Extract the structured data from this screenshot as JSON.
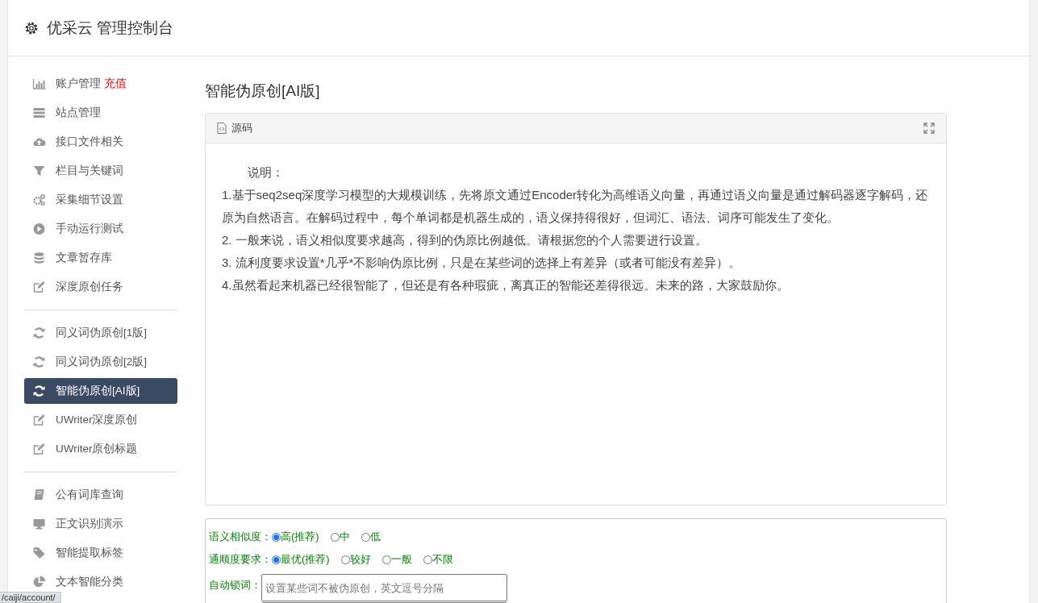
{
  "header": {
    "title": "优采云 管理控制台"
  },
  "sidebar": {
    "groups": [
      [
        {
          "kind": "chart",
          "label": "账户管理",
          "badge": "充值",
          "selected": false
        },
        {
          "kind": "server",
          "label": "站点管理",
          "selected": false
        },
        {
          "kind": "cloud",
          "label": "接口文件相关",
          "selected": false
        },
        {
          "kind": "filter",
          "label": "栏目与关键词",
          "selected": false
        },
        {
          "kind": "gears",
          "label": "采集细节设置",
          "selected": false
        },
        {
          "kind": "play",
          "label": "手动运行测试",
          "selected": false
        },
        {
          "kind": "database",
          "label": "文章暂存库",
          "selected": false
        },
        {
          "kind": "edit",
          "label": "深度原创任务",
          "selected": false
        }
      ],
      [
        {
          "kind": "refresh",
          "label": "同义词伪原创[1版]",
          "selected": false
        },
        {
          "kind": "refresh",
          "label": "同义词伪原创[2版]",
          "selected": false
        },
        {
          "kind": "refresh",
          "label": "智能伪原创[AI版]",
          "selected": true
        },
        {
          "kind": "edit",
          "label": "UWriter深度原创",
          "selected": false
        },
        {
          "kind": "edit",
          "label": "UWriter原创标题",
          "selected": false
        }
      ],
      [
        {
          "kind": "book",
          "label": "公有词库查询",
          "selected": false
        },
        {
          "kind": "monitor",
          "label": "正文识别演示",
          "selected": false
        },
        {
          "kind": "tag",
          "label": "智能提取标签",
          "selected": false
        },
        {
          "kind": "pie",
          "label": "文本智能分类",
          "selected": false
        }
      ]
    ]
  },
  "page_title": "智能伪原创[AI版]",
  "source_panel": {
    "title": "源码",
    "lines": [
      "说明：",
      "1.基于seq2seq深度学习模型的大规模训练，先将原文通过Encoder转化为高维语义向量，再通过语义向量是通过解码器逐字解码，还原为自然语言。在解码过程中，每个单词都是机器生成的，语义保持得很好，但词汇、语法、词序可能发生了变化。",
      "2. 一般来说，语义相似度要求越高，得到的伪原比例越低。请根据您的个人需要进行设置。",
      "3. 流利度要求设置*几乎*不影响伪原比例，只是在某些词的选择上有差异（或者可能没有差异）。",
      "4.虽然看起来机器已经很智能了，但还是有各种瑕疵，离真正的智能还差得很远。未来的路，大家鼓励你。"
    ]
  },
  "form": {
    "rows": [
      {
        "kind": "radio",
        "label": "语义相似度：",
        "options": [
          {
            "label": "高(推荐)",
            "selected": true
          },
          {
            "label": "中",
            "selected": false
          },
          {
            "label": "低",
            "selected": false
          }
        ]
      },
      {
        "kind": "radio",
        "label": "通顺度要求：",
        "options": [
          {
            "label": "最优(推荐)",
            "selected": true
          },
          {
            "label": "较好",
            "selected": false
          },
          {
            "label": "一般",
            "selected": false
          },
          {
            "label": "不限",
            "selected": false
          }
        ]
      },
      {
        "kind": "text",
        "label": "自动锁词：",
        "placeholder": "设置某些词不被伪原创，英文逗号分隔"
      }
    ]
  },
  "status_url": "/caiji/account/"
}
